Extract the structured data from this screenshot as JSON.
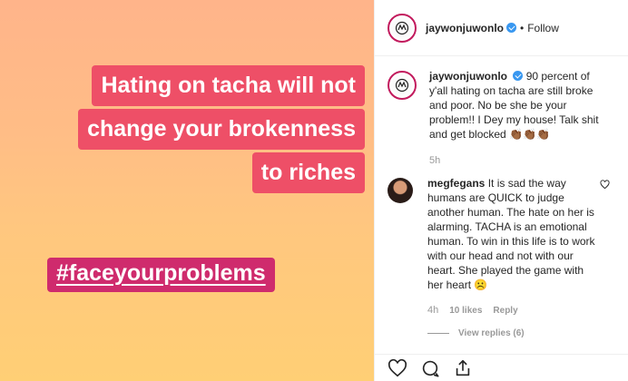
{
  "post_image": {
    "headline_lines": [
      "Hating on tacha will not",
      "change your brokenness",
      "to riches"
    ],
    "hashtag": "#faceyourproblems",
    "colors": {
      "headline_bg": "#ee4f67",
      "hashtag_bg": "#cf2b6d",
      "gradient_top": "#ffb48a",
      "gradient_bottom": "#ffcf75"
    }
  },
  "header": {
    "username": "jaywonjuwonlo",
    "separator": "•",
    "follow_label": "Follow",
    "verified": true
  },
  "caption": {
    "username": "jaywonjuwonlo",
    "text": "90 percent of y'all hating on tacha are still broke and poor. No be she be your problem!! I Dey my house! Talk shit and get blocked 👏🏾👏🏾👏🏾",
    "time": "5h"
  },
  "comment": {
    "username": "megfegans",
    "text": "It is sad the way humans are QUICK to judge another human. The hate on her is alarming. TACHA is an emotional human. To win in this life is to work with our head and not with our heart. She played the game with her heart ☹️",
    "time": "4h",
    "likes": "10 likes",
    "reply_label": "Reply",
    "view_replies": "View replies (6)"
  },
  "actions": [
    "heart-icon",
    "comment-icon",
    "share-icon"
  ]
}
